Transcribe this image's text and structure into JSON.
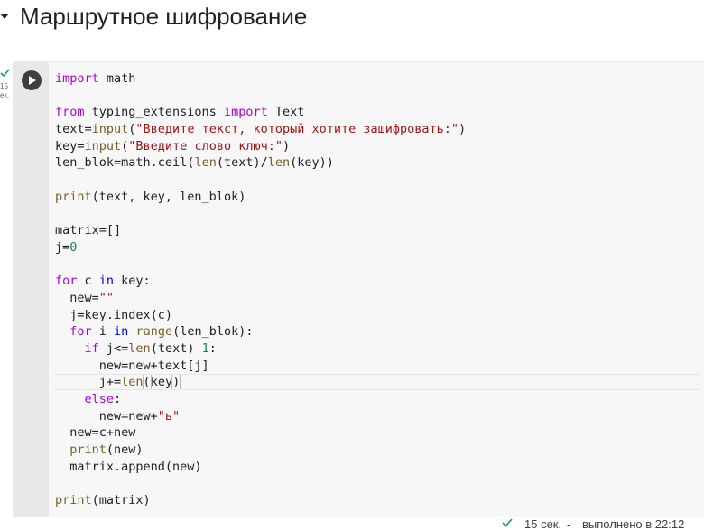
{
  "section": {
    "title": "Маршрутное шифрование"
  },
  "cell": {
    "status_left": [
      "15",
      "ек."
    ],
    "lines": [
      [
        {
          "t": "import",
          "c": "kw"
        },
        {
          "t": " math",
          "c": "txt"
        }
      ],
      [],
      [
        {
          "t": "from",
          "c": "kw"
        },
        {
          "t": " typing_extensions ",
          "c": "txt"
        },
        {
          "t": "import",
          "c": "kw"
        },
        {
          "t": " Text",
          "c": "txt"
        }
      ],
      [
        {
          "t": "text=",
          "c": "txt"
        },
        {
          "t": "input",
          "c": "fn"
        },
        {
          "t": "(",
          "c": "txt"
        },
        {
          "t": "\"Введите текст, который хотите зашифровать:\"",
          "c": "str"
        },
        {
          "t": ")",
          "c": "txt"
        }
      ],
      [
        {
          "t": "key=",
          "c": "txt"
        },
        {
          "t": "input",
          "c": "fn"
        },
        {
          "t": "(",
          "c": "txt"
        },
        {
          "t": "\"Введите слово ключ:\"",
          "c": "str"
        },
        {
          "t": ")",
          "c": "txt"
        }
      ],
      [
        {
          "t": "len_blok=math.ceil(",
          "c": "txt"
        },
        {
          "t": "len",
          "c": "fn"
        },
        {
          "t": "(text)/",
          "c": "txt"
        },
        {
          "t": "len",
          "c": "fn"
        },
        {
          "t": "(key))",
          "c": "txt"
        }
      ],
      [],
      [
        {
          "t": "print",
          "c": "fn"
        },
        {
          "t": "(text, key, len_blok)",
          "c": "txt"
        }
      ],
      [],
      [
        {
          "t": "matrix=[]",
          "c": "txt"
        }
      ],
      [
        {
          "t": "j=",
          "c": "txt"
        },
        {
          "t": "0",
          "c": "num"
        }
      ],
      [],
      [
        {
          "t": "for",
          "c": "kw"
        },
        {
          "t": " c ",
          "c": "txt"
        },
        {
          "t": "in",
          "c": "kb"
        },
        {
          "t": " key:",
          "c": "txt"
        }
      ],
      [
        {
          "t": "  new=",
          "c": "txt"
        },
        {
          "t": "\"\"",
          "c": "str"
        }
      ],
      [
        {
          "t": "  j=key.index(c)",
          "c": "txt"
        }
      ],
      [
        {
          "t": "  ",
          "c": "txt"
        },
        {
          "t": "for",
          "c": "kw"
        },
        {
          "t": " i ",
          "c": "txt"
        },
        {
          "t": "in",
          "c": "kb"
        },
        {
          "t": " ",
          "c": "txt"
        },
        {
          "t": "range",
          "c": "fn"
        },
        {
          "t": "(len_blok):",
          "c": "txt"
        }
      ],
      [
        {
          "t": "    ",
          "c": "txt"
        },
        {
          "t": "if",
          "c": "kw"
        },
        {
          "t": " j<=",
          "c": "txt"
        },
        {
          "t": "len",
          "c": "fn"
        },
        {
          "t": "(text)-",
          "c": "txt"
        },
        {
          "t": "1",
          "c": "num"
        },
        {
          "t": ":",
          "c": "txt"
        }
      ],
      [
        {
          "t": "      new=new+text[j]",
          "c": "txt"
        }
      ],
      [
        {
          "t": "      j+=",
          "c": "txt"
        },
        {
          "t": "len",
          "c": "fn"
        },
        {
          "t": "(",
          "c": "txt bracket-match"
        },
        {
          "t": "key",
          "c": "txt"
        },
        {
          "t": ")",
          "c": "txt bracket-match"
        }
      ],
      [
        {
          "t": "    ",
          "c": "txt"
        },
        {
          "t": "else",
          "c": "kw"
        },
        {
          "t": ":",
          "c": "txt"
        }
      ],
      [
        {
          "t": "      new=new+",
          "c": "txt"
        },
        {
          "t": "\"ь\"",
          "c": "str"
        }
      ],
      [
        {
          "t": "  new=c+new",
          "c": "txt"
        }
      ],
      [
        {
          "t": "  ",
          "c": "txt"
        },
        {
          "t": "print",
          "c": "fn"
        },
        {
          "t": "(new)",
          "c": "txt"
        }
      ],
      [
        {
          "t": "  matrix.append(new)",
          "c": "txt"
        }
      ],
      [],
      [
        {
          "t": "print",
          "c": "fn"
        },
        {
          "t": "(matrix)",
          "c": "txt"
        }
      ]
    ],
    "current_line": 18
  },
  "statusbar": {
    "time": "15 сек.",
    "separator": "-",
    "completed": "выполнено в 22:12"
  },
  "colors": {
    "keyword": "#af00db",
    "builtin": "#795e26",
    "string": "#a31515",
    "number": "#098658",
    "check": "#0f9d58"
  },
  "icons": {
    "collapse": "triangle-down-icon",
    "run": "play-circle-icon",
    "status": "check-icon"
  }
}
